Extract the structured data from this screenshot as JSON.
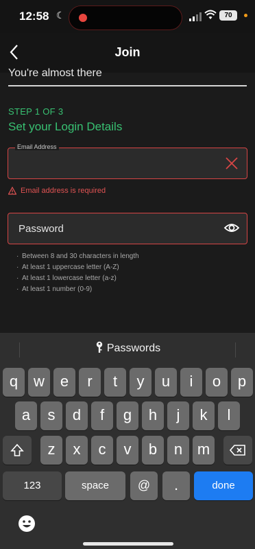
{
  "status_bar": {
    "time": "12:58",
    "battery": "70"
  },
  "nav": {
    "title": "Join"
  },
  "form": {
    "almost_there": "You're almost there",
    "step": "STEP 1 OF 3",
    "heading": "Set your Login Details",
    "email": {
      "label": "Email Address",
      "value": "",
      "error": "Email address is required"
    },
    "password": {
      "placeholder": "Password"
    },
    "rules": [
      "Between 8 and 30 characters in length",
      "At least 1 uppercase letter (A-Z)",
      "At least 1 lowercase letter (a-z)",
      "At least 1 number (0-9)"
    ]
  },
  "keyboard": {
    "passwords_label": "Passwords",
    "row1": [
      "q",
      "w",
      "e",
      "r",
      "t",
      "y",
      "u",
      "i",
      "o",
      "p"
    ],
    "row2": [
      "a",
      "s",
      "d",
      "f",
      "g",
      "h",
      "j",
      "k",
      "l"
    ],
    "row3": [
      "z",
      "x",
      "c",
      "v",
      "b",
      "n",
      "m"
    ],
    "numbers_label": "123",
    "space_label": "space",
    "at_label": "@",
    "dot_label": ".",
    "done_label": "done"
  },
  "colors": {
    "accent_green": "#38c172",
    "error_red": "#d64545",
    "done_blue": "#1d7cf2"
  }
}
